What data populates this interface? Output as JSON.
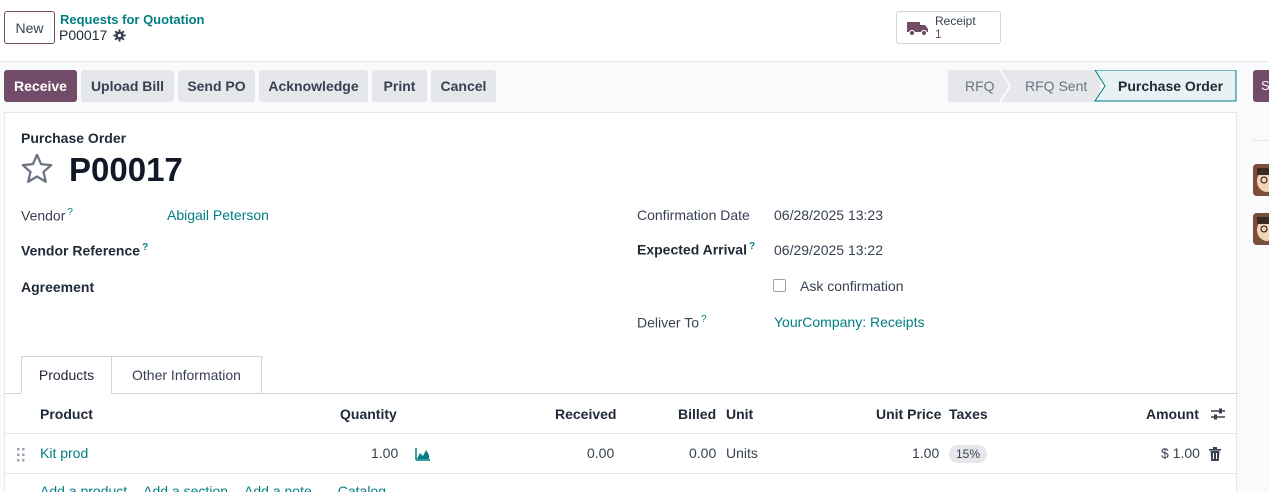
{
  "topbar": {
    "new_label": "New",
    "breadcrumb_parent": "Requests for Quotation",
    "breadcrumb_current": "P00017",
    "smart_button": {
      "label": "Receipt",
      "value": "1",
      "icon": "truck-icon"
    }
  },
  "actions": {
    "receive": "Receive",
    "upload_bill": "Upload Bill",
    "send_po": "Send PO",
    "acknowledge": "Acknowledge",
    "print": "Print",
    "cancel": "Cancel"
  },
  "statusbar": {
    "steps": [
      "RFQ",
      "RFQ Sent",
      "Purchase Order"
    ],
    "active": "Purchase Order"
  },
  "form": {
    "doc_type": "Purchase Order",
    "name": "P00017",
    "vendor_label": "Vendor",
    "vendor_value": "Abigail Peterson",
    "vendor_ref_label": "Vendor Reference",
    "agreement_label": "Agreement",
    "confirmation_date_label": "Confirmation Date",
    "confirmation_date_value": "06/28/2025 13:23",
    "expected_arrival_label": "Expected Arrival",
    "expected_arrival_value": "06/29/2025 13:22",
    "ask_confirmation_label": "Ask confirmation",
    "deliver_to_label": "Deliver To",
    "deliver_to_value": "YourCompany: Receipts",
    "help_mark": "?"
  },
  "tabs": [
    "Products",
    "Other Information"
  ],
  "table": {
    "columns": {
      "product": "Product",
      "quantity": "Quantity",
      "received": "Received",
      "billed": "Billed",
      "unit": "Unit",
      "unit_price": "Unit Price",
      "taxes": "Taxes",
      "amount": "Amount"
    },
    "rows": [
      {
        "product": "Kit prod",
        "quantity": "1.00",
        "received": "0.00",
        "billed": "0.00",
        "unit": "Units",
        "unit_price": "1.00",
        "taxes": "15%",
        "amount": "$ 1.00"
      }
    ],
    "add_links": [
      "Add a product",
      "Add a section",
      "Add a note",
      "Catalog"
    ]
  },
  "colors": {
    "primary": "#714b67",
    "link": "#017e84"
  }
}
